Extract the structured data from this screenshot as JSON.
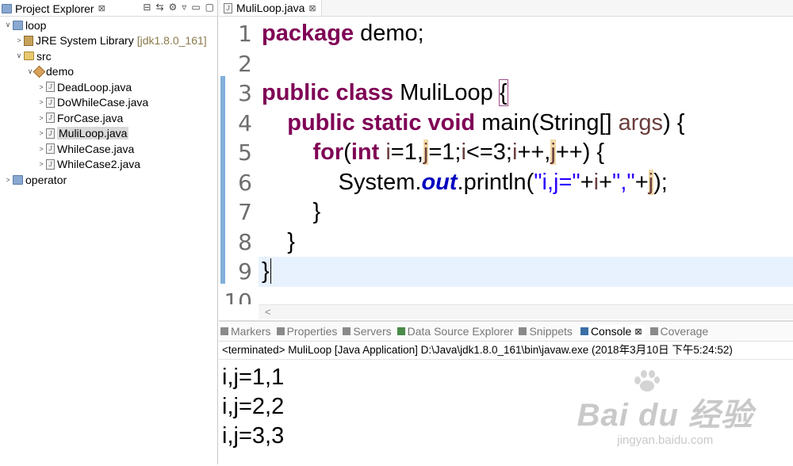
{
  "project_explorer": {
    "tab_label": "Project Explorer",
    "close": "⊠",
    "tree": [
      {
        "label": "loop",
        "indent": 0,
        "arrow": "∨",
        "icon": "project-icon"
      },
      {
        "label": "JRE System Library",
        "extra": "[jdk1.8.0_161]",
        "indent": 1,
        "arrow": ">",
        "icon": "library-icon"
      },
      {
        "label": "src",
        "indent": 1,
        "arrow": "∨",
        "icon": "source-folder-icon"
      },
      {
        "label": "demo",
        "indent": 2,
        "arrow": "∨",
        "icon": "package-icon"
      },
      {
        "label": "DeadLoop.java",
        "indent": 3,
        "arrow": ">",
        "icon": "java-file-icon"
      },
      {
        "label": "DoWhileCase.java",
        "indent": 3,
        "arrow": ">",
        "icon": "java-file-icon"
      },
      {
        "label": "ForCase.java",
        "indent": 3,
        "arrow": ">",
        "icon": "java-file-icon"
      },
      {
        "label": "MuliLoop.java",
        "indent": 3,
        "arrow": ">",
        "icon": "java-file-icon",
        "selected": true
      },
      {
        "label": "WhileCase.java",
        "indent": 3,
        "arrow": ">",
        "icon": "java-file-icon"
      },
      {
        "label": "WhileCase2.java",
        "indent": 3,
        "arrow": ">",
        "icon": "java-file-icon"
      },
      {
        "label": "operator",
        "indent": 0,
        "arrow": ">",
        "icon": "project-icon"
      }
    ]
  },
  "editor": {
    "tab_label": "MuliLoop.java",
    "close": "⊠",
    "line_numbers": [
      "1",
      "2",
      "3",
      "4",
      "5",
      "6",
      "7",
      "8",
      "9",
      "10"
    ],
    "scroll_left": "<"
  },
  "console": {
    "tabs": [
      {
        "label": "Markers",
        "color": "#8a8a8a"
      },
      {
        "label": "Properties",
        "color": "#8a8a8a"
      },
      {
        "label": "Servers",
        "color": "#8a8a8a"
      },
      {
        "label": "Data Source Explorer",
        "color": "#4a8a4a"
      },
      {
        "label": "Snippets",
        "color": "#8a8a8a"
      },
      {
        "label": "Console",
        "color": "#3a6ea5",
        "active": true,
        "close": "⊠"
      },
      {
        "label": "Coverage",
        "color": "#8a8a8a"
      }
    ],
    "terminated": "<terminated> MuliLoop [Java Application] D:\\Java\\jdk1.8.0_161\\bin\\javaw.exe (2018年3月10日 下午5:24:52)",
    "output": [
      "i,j=1,1",
      "i,j=2,2",
      "i,j=3,3"
    ]
  },
  "watermark": {
    "brand": "Bai du 经验",
    "url": "jingyan.baidu.com"
  }
}
